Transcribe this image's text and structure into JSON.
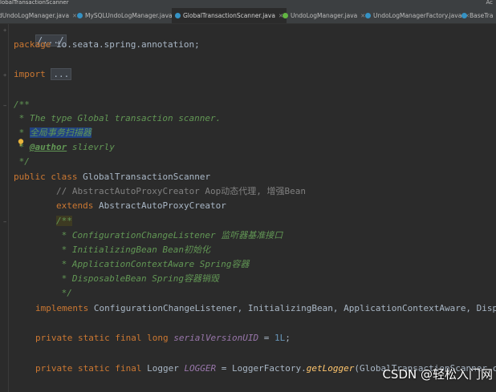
{
  "window": {
    "title": "lobalTransactionScanner",
    "right_label": "Ac"
  },
  "tabs": [
    {
      "label": "dUndoLogManager.java",
      "icon": "class-icon"
    },
    {
      "label": "MySQLUndoLogManager.java",
      "icon": "class-icon"
    },
    {
      "label": "GlobalTransactionScanner.java",
      "icon": "class-icon",
      "active": true
    },
    {
      "label": "UndoLogManager.java",
      "icon": "interface-icon"
    },
    {
      "label": "UndoLogManagerFactory.java",
      "icon": "class-icon"
    },
    {
      "label": "BaseTra",
      "icon": "class-icon"
    }
  ],
  "code": {
    "header_fold": "/.../",
    "package_kw": "package",
    "package_name": " io.seata.spring.annotation;",
    "import_kw": "import",
    "import_fold": "...",
    "doc_open": "/**",
    "doc_line1": " * The type Global transaction scanner.",
    "doc_line2_prefix": " * ",
    "doc_line2_text": "全局事务扫描器",
    "doc_line3_prefix": " * ",
    "doc_line3_tag": "@author",
    "doc_line3_text": " slievrly",
    "doc_close": " */",
    "class_kw1": "public",
    "class_kw2": "class",
    "class_name": " GlobalTransactionScanner",
    "comment_line": "// AbstractAutoProxyCreator Aop动态代理, 增强Bean",
    "extends_kw": "extends",
    "extends_name": " AbstractAutoProxyCreator",
    "doc2_open": "/**",
    "doc2_line1": " * ConfigurationChangeListener 监听器基准接口",
    "doc2_line2": " * InitializingBean Bean初始化",
    "doc2_line3": " * ApplicationContextAware Spring容器",
    "doc2_line4": " * DisposableBean Spring容器销毁",
    "doc2_close": " */",
    "implements_kw": "implements",
    "implements_list": " ConfigurationChangeListener, InitializingBean, ApplicationContextAware, Disp",
    "field1_kw": "private static final long",
    "field1_name": "serialVersionUID",
    "field1_eq": " = ",
    "field1_val": "1L",
    "field1_end": ";",
    "field2_kw": "private static final",
    "field2_type": " Logger ",
    "field2_name": "LOGGER",
    "field2_eq": " = LoggerFactory.",
    "field2_method": "getLogger",
    "field2_rest": "(GlobalTransactionScanner.c"
  },
  "watermark": "CSDN @轻松入门网",
  "colors": {
    "background": "#2b2b2b",
    "keyword": "#cc7832",
    "doc_comment": "#629755",
    "line_comment": "#808080",
    "static_field": "#9876aa",
    "number": "#6897bb",
    "selection": "#214283"
  }
}
